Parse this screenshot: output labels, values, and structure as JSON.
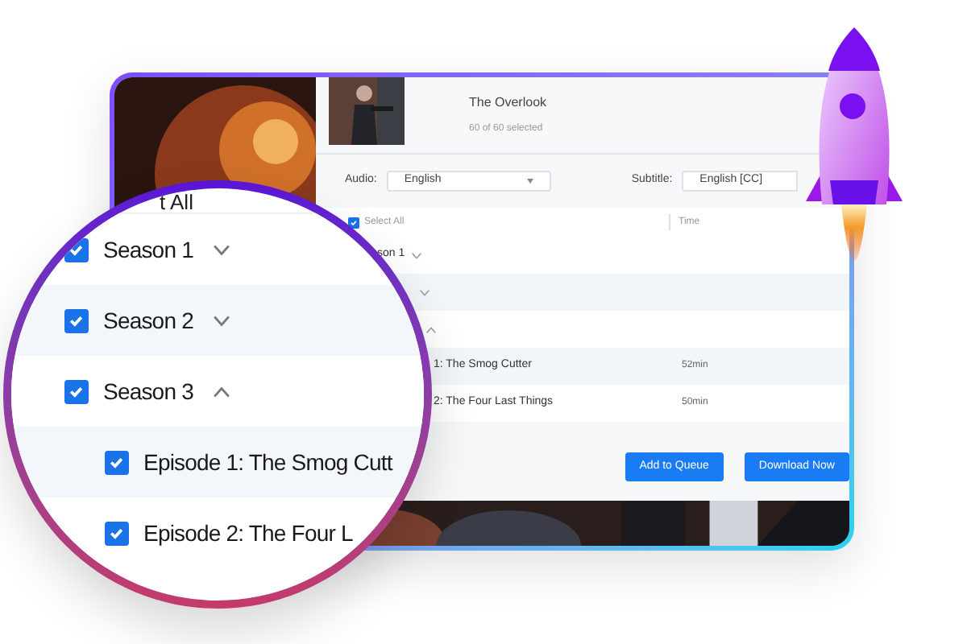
{
  "header": {
    "title": "The Overlook",
    "selection_count": "60 of 60 selected"
  },
  "audio": {
    "label": "Audio:",
    "value": "English"
  },
  "subtitle": {
    "label": "Subtitle:",
    "value": "English [CC]"
  },
  "list_header": {
    "select_all": {
      "label": "Select All",
      "checked": true
    },
    "time_column": "Time"
  },
  "rows": [
    {
      "kind": "season",
      "label": "son 1",
      "expanded": false
    },
    {
      "kind": "season",
      "expanded": false
    },
    {
      "kind": "season",
      "expanded": true
    },
    {
      "kind": "episode",
      "label": "1: The Smog Cutter",
      "time": "52min"
    },
    {
      "kind": "episode",
      "label": "2: The Four Last Things",
      "time": "50min"
    }
  ],
  "buttons": [
    "Add to Queue",
    "Download Now"
  ],
  "magnifier": {
    "header_fragment": "t All",
    "rows": [
      {
        "kind": "season",
        "label": "Season 1",
        "checked": true,
        "expanded": false
      },
      {
        "kind": "season",
        "label": "Season 2",
        "checked": true,
        "expanded": false
      },
      {
        "kind": "season",
        "label": "Season 3",
        "checked": true,
        "expanded": true
      },
      {
        "kind": "episode",
        "label": "Episode 1: The Smog Cutt",
        "checked": true
      },
      {
        "kind": "episode",
        "label": "Episode 2: The Four L",
        "checked": true
      }
    ]
  }
}
